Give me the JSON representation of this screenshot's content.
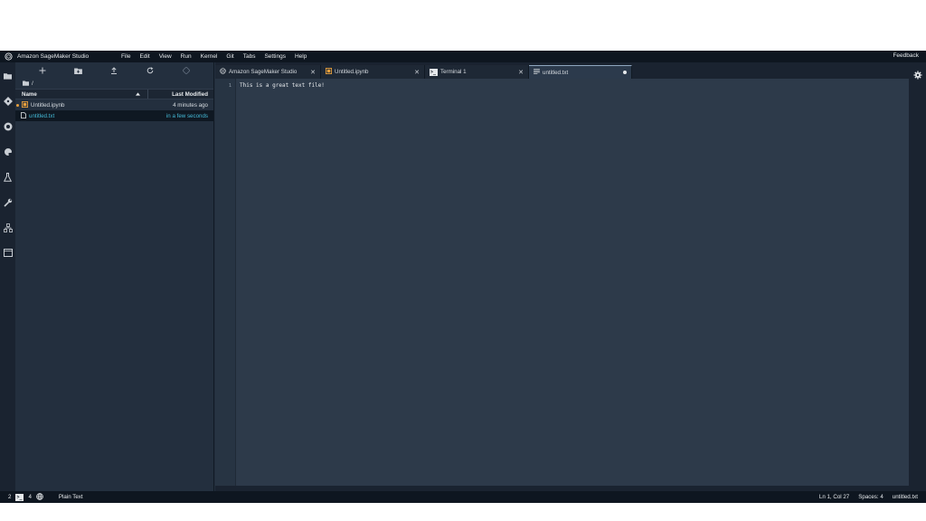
{
  "menubar": {
    "app_title": "Amazon SageMaker Studio",
    "items": [
      "File",
      "Edit",
      "View",
      "Run",
      "Kernel",
      "Git",
      "Tabs",
      "Settings",
      "Help"
    ],
    "feedback": "Feedback"
  },
  "activity_icons": [
    "folder-icon",
    "git-icon",
    "running-icon",
    "palette-icon",
    "flask-icon",
    "wrench-icon",
    "network-icon",
    "window-icon"
  ],
  "file_browser": {
    "path": "/",
    "header": {
      "name": "Name",
      "last_modified": "Last Modified"
    },
    "files": [
      {
        "name": "Untitled.ipynb",
        "modified": "4 minutes ago",
        "type": "notebook"
      },
      {
        "name": "untitled.txt",
        "modified": "in a few seconds",
        "type": "text"
      }
    ]
  },
  "tabs": [
    {
      "label": "Amazon SageMaker Studio",
      "icon": "sagemaker-icon"
    },
    {
      "label": "Untitled.ipynb",
      "icon": "notebook-icon"
    },
    {
      "label": "Terminal 1",
      "icon": "terminal-icon"
    },
    {
      "label": "untitled.txt",
      "icon": "text-file-icon"
    }
  ],
  "editor": {
    "line_number": "1",
    "content": "This is a great text file!"
  },
  "statusbar": {
    "left_count_1": "2",
    "left_count_2": "4",
    "mode": "Plain Text",
    "position": "Ln 1, Col 27",
    "spaces": "Spaces: 4",
    "filename": "untitled.txt"
  },
  "colors": {
    "accent": "#44b9d6",
    "notebook_orange": "#e79f3c",
    "background": "#232f3e"
  }
}
